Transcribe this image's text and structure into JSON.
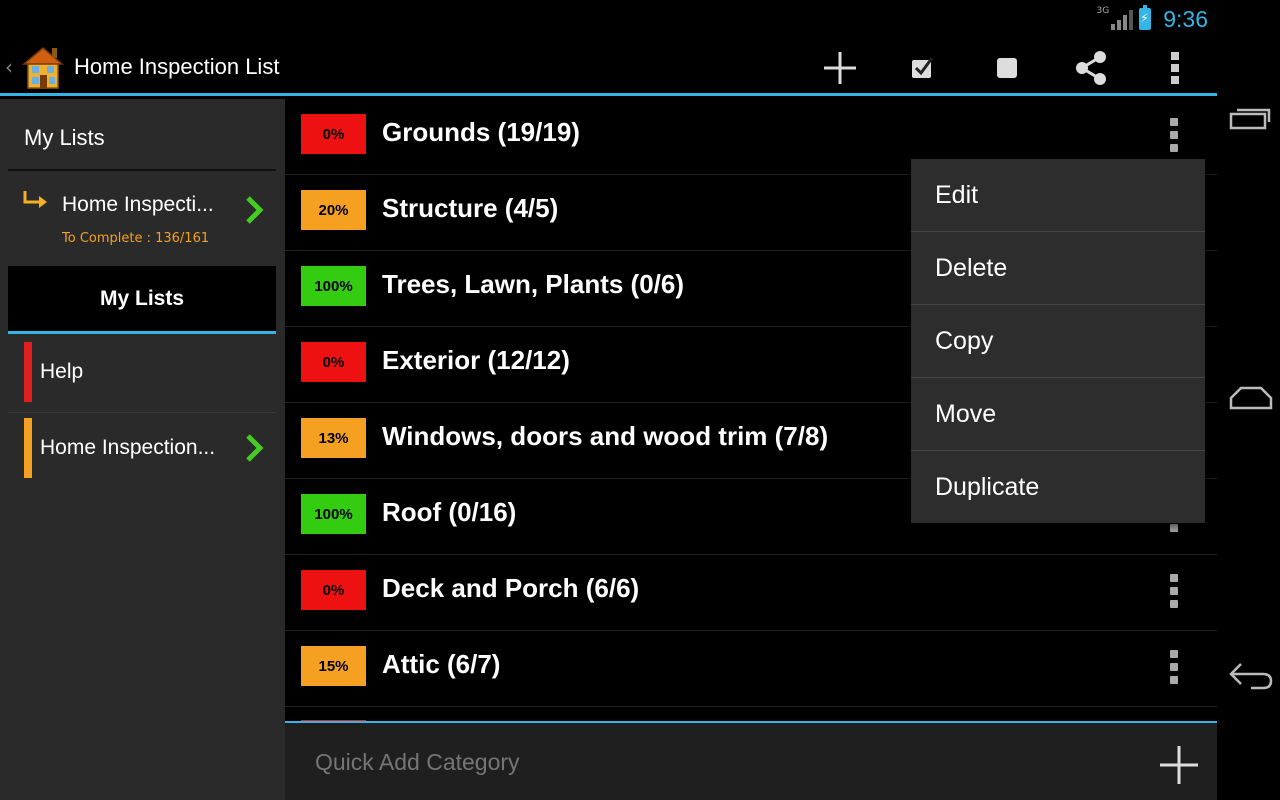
{
  "status_bar": {
    "network": "3G",
    "time": "9:36"
  },
  "action_bar": {
    "title": "Home Inspection List",
    "icons": [
      "back-caret-icon",
      "house-app-icon",
      "add-icon",
      "check-all-icon",
      "uncheck-all-icon",
      "share-icon",
      "overflow-menu-icon"
    ]
  },
  "sidebar": {
    "header": "My Lists",
    "current": {
      "title": "Home Inspecti...",
      "subtitle": "To Complete : 136/161"
    },
    "tab_label": "My Lists",
    "items": [
      {
        "label": "Help",
        "color": "#e02020"
      },
      {
        "label": "Home Inspection...",
        "color": "#f5a020"
      }
    ]
  },
  "categories": [
    {
      "percent": "0%",
      "title": "Grounds (19/19)",
      "color": "#ee1111"
    },
    {
      "percent": "20%",
      "title": "Structure (4/5)",
      "color": "#f5a020"
    },
    {
      "percent": "100%",
      "title": "Trees, Lawn, Plants (0/6)",
      "color": "#33cc11"
    },
    {
      "percent": "0%",
      "title": "Exterior (12/12)",
      "color": "#ee1111"
    },
    {
      "percent": "13%",
      "title": "Windows, doors and wood trim (7/8)",
      "color": "#f5a020"
    },
    {
      "percent": "100%",
      "title": "Roof (0/16)",
      "color": "#33cc11"
    },
    {
      "percent": "0%",
      "title": "Deck and Porch (6/6)",
      "color": "#ee1111"
    },
    {
      "percent": "15%",
      "title": "Attic (6/7)",
      "color": "#f5a020"
    }
  ],
  "quick_add": {
    "placeholder": "Quick Add Category"
  },
  "popup_menu": {
    "items": [
      "Edit",
      "Delete",
      "Copy",
      "Move",
      "Duplicate"
    ]
  },
  "colors": {
    "accent": "#33b5e5",
    "red": "#ee1111",
    "orange": "#f5a020",
    "green": "#33cc11"
  }
}
